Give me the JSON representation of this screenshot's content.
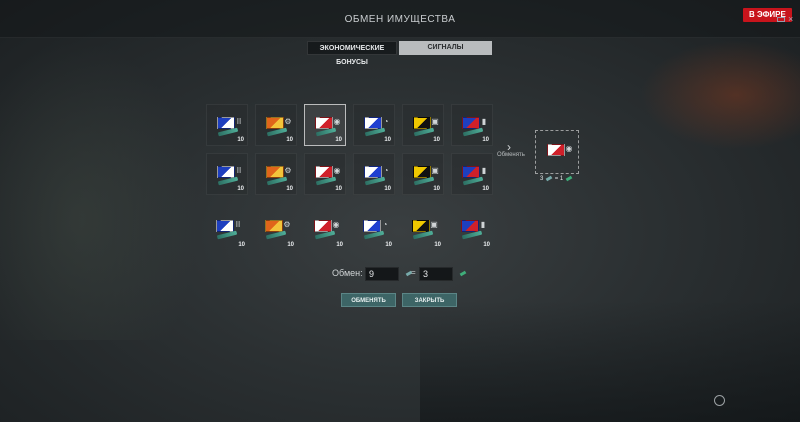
{
  "window": {
    "title": "ОБМЕН ИМУЩЕСТВА",
    "live_badge": "В ЭФИРЕ",
    "close_glyph": "×"
  },
  "tabs": [
    {
      "label": "ЭКОНОМИЧЕСКИЕ БОНУСЫ",
      "active": false
    },
    {
      "label": "СИГНАЛЫ",
      "active": true
    }
  ],
  "signals": {
    "rows": [
      {
        "style": "boxed",
        "items": [
          {
            "name": "signal-blue-white-check",
            "count": "10",
            "colors": [
              "#1e3fbf",
              "#ffffff"
            ],
            "mark": "II"
          },
          {
            "name": "signal-orange-red-stripe",
            "count": "10",
            "colors": [
              "#e0651a",
              "#f3c43a"
            ],
            "mark": "⚙"
          },
          {
            "name": "signal-white-red-diamond",
            "count": "10",
            "colors": [
              "#ffffff",
              "#d0202a"
            ],
            "mark": "◉"
          },
          {
            "name": "signal-blue-white-square",
            "count": "10",
            "colors": [
              "#ffffff",
              "#1f3fd0"
            ],
            "mark": "◔"
          },
          {
            "name": "signal-yellow-black-dot",
            "count": "10",
            "colors": [
              "#f0c800",
              "#111111"
            ],
            "mark": "▣"
          },
          {
            "name": "signal-blue-red-white-band",
            "count": "10",
            "colors": [
              "#1e3fbf",
              "#d0202a"
            ],
            "mark": "▮"
          }
        ]
      },
      {
        "style": "boxed",
        "items": [
          {
            "name": "signal-blue-white-check",
            "count": "10",
            "colors": [
              "#1e3fbf",
              "#ffffff"
            ],
            "mark": "II"
          },
          {
            "name": "signal-orange-red-stripe",
            "count": "10",
            "colors": [
              "#e0651a",
              "#f3c43a"
            ],
            "mark": "⚙"
          },
          {
            "name": "signal-white-red-diamond",
            "count": "10",
            "colors": [
              "#ffffff",
              "#d0202a"
            ],
            "mark": "◉"
          },
          {
            "name": "signal-blue-white-square",
            "count": "10",
            "colors": [
              "#ffffff",
              "#1f3fd0"
            ],
            "mark": "◔"
          },
          {
            "name": "signal-yellow-black-dot",
            "count": "10",
            "colors": [
              "#f0c800",
              "#111111"
            ],
            "mark": "▣"
          },
          {
            "name": "signal-blue-red-white-band",
            "count": "10",
            "colors": [
              "#1e3fbf",
              "#d0202a"
            ],
            "mark": "▮"
          }
        ]
      },
      {
        "style": "plain",
        "items": [
          {
            "name": "signal-blue-white-check",
            "count": "10",
            "colors": [
              "#1e3fbf",
              "#ffffff"
            ],
            "mark": "II"
          },
          {
            "name": "signal-orange-red-stripe",
            "count": "10",
            "colors": [
              "#e0651a",
              "#f3c43a"
            ],
            "mark": "⚙"
          },
          {
            "name": "signal-white-red-diamond",
            "count": "10",
            "colors": [
              "#ffffff",
              "#d0202a"
            ],
            "mark": "◉"
          },
          {
            "name": "signal-blue-white-square",
            "count": "10",
            "colors": [
              "#ffffff",
              "#1f3fd0"
            ],
            "mark": "◔"
          },
          {
            "name": "signal-yellow-black-dot",
            "count": "10",
            "colors": [
              "#f0c800",
              "#111111"
            ],
            "mark": "▣"
          },
          {
            "name": "signal-blue-red-white-band",
            "count": "10",
            "colors": [
              "#1e3fbf",
              "#d0202a"
            ],
            "mark": "▮"
          }
        ]
      }
    ],
    "selected": {
      "row": 0,
      "col": 2
    }
  },
  "exchange_arrow": {
    "glyph": "›",
    "label": "Обменять"
  },
  "result": {
    "signal": {
      "name": "signal-white-red-diamond",
      "colors": [
        "#ffffff",
        "#d0202a"
      ],
      "mark": "◉"
    },
    "rate_left": "3",
    "rate_mid": "= 1"
  },
  "exchange_form": {
    "label": "Обмен:",
    "input_value": "9",
    "equals": "=",
    "output_value": "3"
  },
  "buttons": {
    "exchange": "ОБМЕНЯТЬ",
    "close": "ЗАКРЫТЬ"
  }
}
